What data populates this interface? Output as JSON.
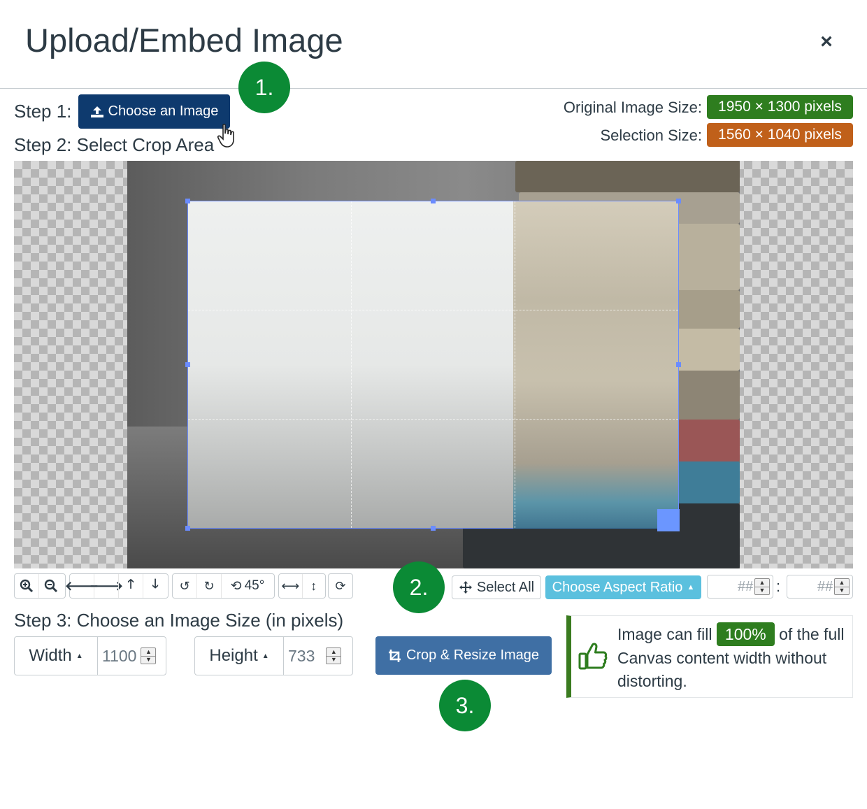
{
  "header": {
    "title": "Upload/Embed Image",
    "close_symbol": "×"
  },
  "step1": {
    "label": "Step 1:",
    "choose_button": "Choose an Image"
  },
  "step2": {
    "label": "Step 2: Select Crop Area"
  },
  "step3": {
    "label": "Step 3: Choose an Image Size (in pixels)"
  },
  "callouts": {
    "one": "1.",
    "two": "2.",
    "three": "3."
  },
  "info": {
    "original_label": "Original Image Size:",
    "original_value": "1950 × 1300 pixels",
    "selection_label": "Selection Size:",
    "selection_value": "1560 × 1040 pixels"
  },
  "toolbar": {
    "rotate_label": "45°",
    "select_all": "Select All",
    "aspect_ratio": "Choose Aspect Ratio",
    "ratio_w_placeholder": "##",
    "ratio_sep": ":",
    "ratio_h_placeholder": "##"
  },
  "size": {
    "width_label": "Width",
    "width_value": "1100",
    "height_label": "Height",
    "height_value": "733",
    "crop_button": "Crop & Resize Image"
  },
  "notice": {
    "text_before": "Image can fill",
    "percent": "100%",
    "text_after": "of the full Canvas content width without distorting."
  },
  "colors": {
    "primary_dark": "#0e3a6e",
    "callout_green": "#0b8a35",
    "original_pill": "#2e7d1f",
    "selection_pill": "#c0601a",
    "aspect_button": "#5bc0de",
    "crop_button": "#3f6fa4",
    "crop_border": "#6b8cff"
  }
}
